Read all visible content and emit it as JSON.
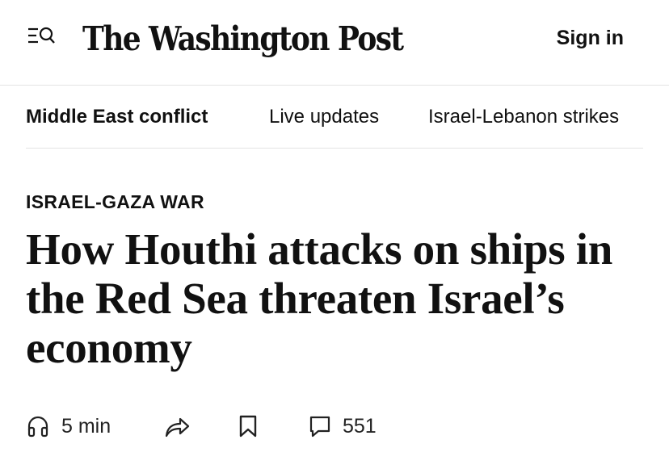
{
  "header": {
    "masthead": "The Washington Post",
    "sign_in": "Sign in",
    "menu_icon": "menu-search-icon"
  },
  "subnav": {
    "items": [
      {
        "label": "Middle East conflict"
      },
      {
        "label": "Live updates"
      },
      {
        "label": "Israel-Lebanon strikes"
      }
    ]
  },
  "article": {
    "kicker": "ISRAEL-GAZA WAR",
    "headline": "How Houthi attacks on ships in the Red Sea threaten Israel’s economy"
  },
  "actions": {
    "listen": {
      "icon": "headphones-icon",
      "label": "5 min"
    },
    "share": {
      "icon": "share-icon"
    },
    "save": {
      "icon": "bookmark-icon"
    },
    "comments": {
      "icon": "comment-icon",
      "count": "551"
    }
  }
}
